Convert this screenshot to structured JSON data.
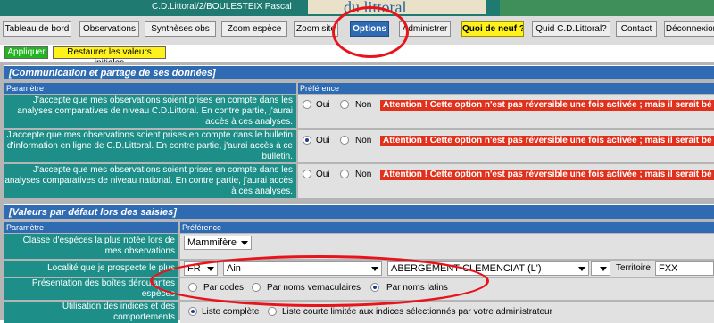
{
  "header": {
    "user": "C.D.Littoral/2/BOULESTEIX Pascal",
    "banner_text": "du littoral"
  },
  "nav": {
    "tabs": [
      {
        "label": "Tableau de bord",
        "state": "normal"
      },
      {
        "label": "Observations",
        "state": "normal"
      },
      {
        "label": "Synthèses obs",
        "state": "normal"
      },
      {
        "label": "Zoom espèce",
        "state": "normal"
      },
      {
        "label": "Zoom site",
        "state": "normal"
      },
      {
        "label": "Options",
        "state": "active"
      },
      {
        "label": "Administrer",
        "state": "normal"
      },
      {
        "label": "Quoi de neuf ?",
        "state": "highlight"
      },
      {
        "label": "Quid C.D.Littoral?",
        "state": "normal"
      },
      {
        "label": "Contact",
        "state": "normal"
      },
      {
        "label": "Déconnexion",
        "state": "normal"
      }
    ]
  },
  "actions": {
    "apply": "Appliquer",
    "reset": "Restaurer les valeurs initiales"
  },
  "section1": {
    "title": "[Communication et partage de ses données]",
    "col_param": "Paramètre",
    "col_pref": "Préférence",
    "rows": [
      {
        "label": "J'accepte que mes observations soient prises en compte dans les analyses comparatives de niveau C.D.Littoral. En contre partie, j'aurai accès à ces analyses.",
        "opt_yes": "Oui",
        "opt_no": "Non",
        "warning": "Attention ! Cette option n'est pas réversible une fois activée ; mais il serait bé"
      },
      {
        "label": "J'accepte que mes observations soient prises en compte dans le bulletin d'information en ligne de C.D.Littoral. En contre partie, j'aurai accès à ce bulletin.",
        "opt_yes": "Oui",
        "opt_no": "Non",
        "warning": "Attention ! Cette option n'est pas réversible une fois activée ; mais il serait bé"
      },
      {
        "label": "J'accepte que mes observations soient prises en compte dans les analyses comparatives de niveau national. En contre partie, j'aurai accès à ces analyses.",
        "opt_yes": "Oui",
        "opt_no": "Non",
        "warning": "Attention ! Cette option n'est pas réversible une fois activée ; mais il serait bé"
      }
    ]
  },
  "section2": {
    "title": "[Valeurs par défaut lors des saisies]",
    "col_param": "Paramètre",
    "col_pref": "Préférence",
    "class_label": "Classe d'espèces la plus notée lors de mes observations",
    "class_value": "Mammifère",
    "locality_label": "Localité que je prospecte le plus",
    "country_value": "FR",
    "dept_value": "Ain",
    "commune_value": "ABERGEMENT-CLEMENCIAT (L')",
    "territory_label": "Territoire",
    "territory_value": "FXX",
    "presentation_label": "Présentation des boîtes déroulantes espèces",
    "pres_opt1": "Par codes",
    "pres_opt2": "Par noms vernaculaires",
    "pres_opt3": "Par noms latins",
    "indices_label": "Utilisation des indices et des comportements",
    "indices_opt1": "Liste complète",
    "indices_opt2": "Liste courte limitée aux indices sélectionnés par votre administrateur"
  }
}
